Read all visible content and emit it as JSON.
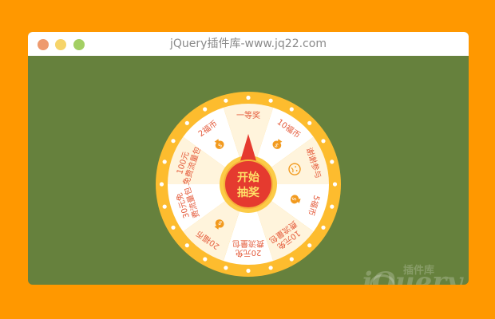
{
  "page": {
    "background": "#FF9800"
  },
  "window": {
    "title": "jQuery插件库-www.jq22.com",
    "background": "#66813D"
  },
  "wheel": {
    "prizes": [
      {
        "label": "一等奖",
        "icon": "none"
      },
      {
        "label": "10福币",
        "icon": "money-bag-icon"
      },
      {
        "label": "谢谢参与",
        "icon": "sad-face-icon"
      },
      {
        "label": "5福币",
        "icon": "money-bag-icon"
      },
      {
        "label": "10元免费流量包",
        "icon": "none"
      },
      {
        "label": "20元免费流量包",
        "icon": "none"
      },
      {
        "label": "20福币",
        "icon": "money-bag-icon"
      },
      {
        "label": "30元免费流量包",
        "icon": "none"
      },
      {
        "label": "100元免费流量包",
        "icon": "none"
      },
      {
        "label": "2福币",
        "icon": "money-bag-icon"
      }
    ],
    "center_button": {
      "line1": "开始",
      "line2": "抽奖"
    },
    "colors": {
      "rim": "#FDBC2E",
      "sector_a": "#FFF4DC",
      "sector_b": "#FFFFFF",
      "text": "#E45B3B",
      "button": "#E53A2F",
      "button_text": "#FFE168"
    }
  },
  "watermark": {
    "text": "jQuery",
    "small": "插件库"
  }
}
